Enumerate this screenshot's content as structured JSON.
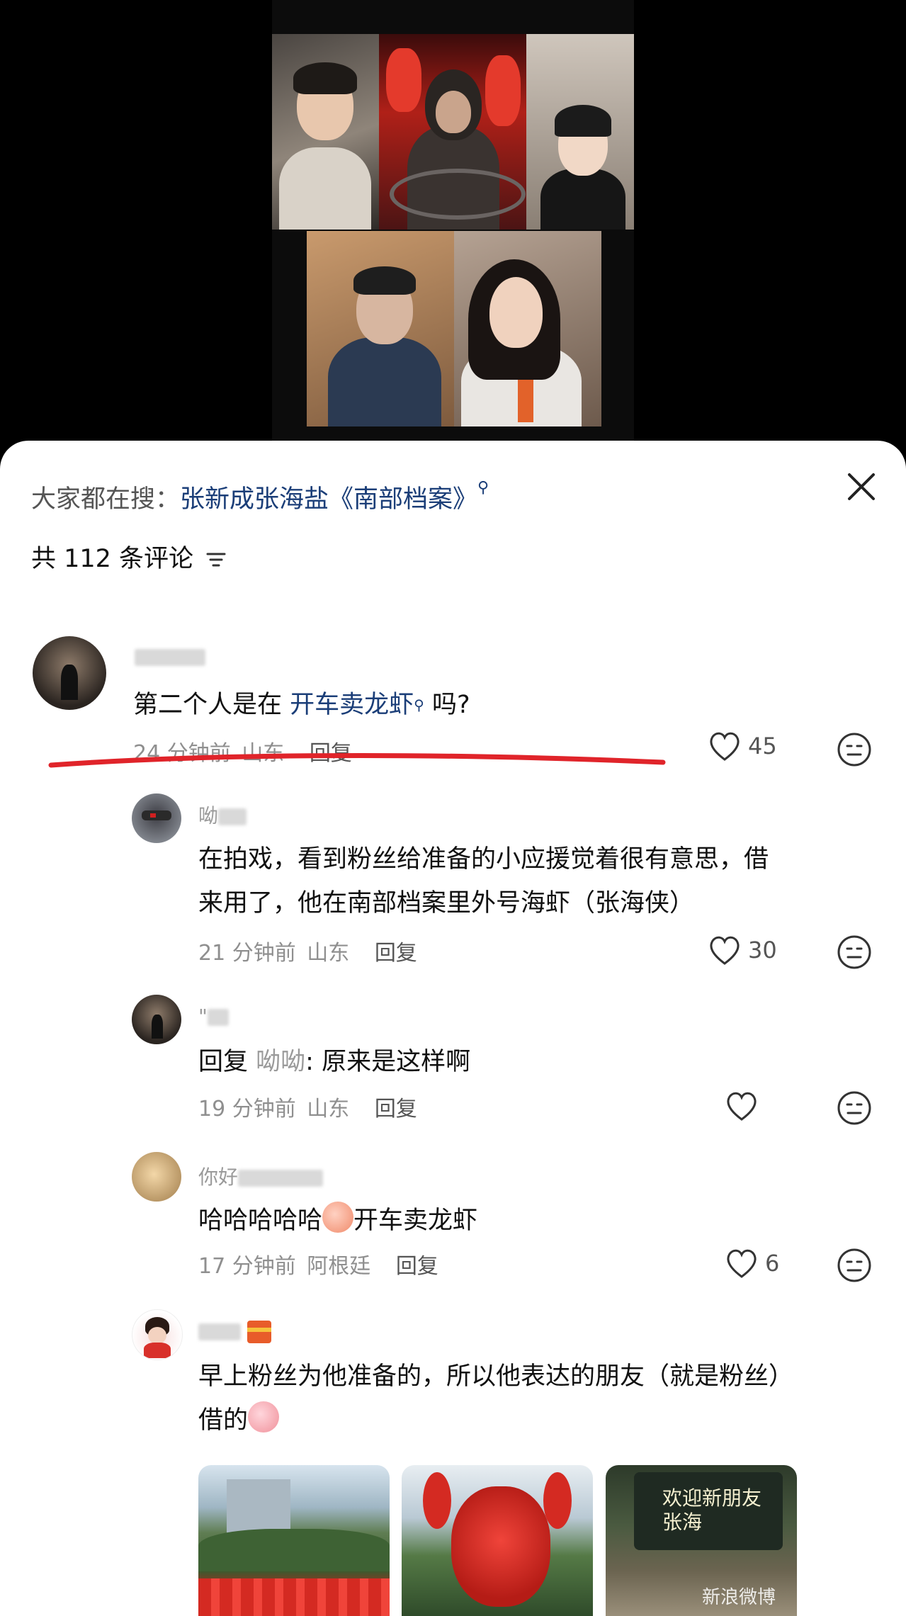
{
  "search_bar": {
    "prefix": "大家都在搜：",
    "keyword": "张新成张海盐《南部档案》",
    "icon": "search-icon"
  },
  "comments_header": {
    "label": "共 112 条评论",
    "icon": "sort-icon"
  },
  "comments": [
    {
      "username_visible": "",
      "text_before": "第二个人是在 ",
      "link_text": "开车卖龙虾",
      "text_after": " 吗?",
      "time": "24 分钟前",
      "location": "山东",
      "reply_label": "回复",
      "likes": "45"
    },
    {
      "username_visible": "呦",
      "line1": "在拍戏，看到粉丝给准备的小应援觉着很有意思，借",
      "line2": "来用了，他在南部档案里外号海虾（张海侠）",
      "time": "21 分钟前",
      "location": "山东",
      "reply_label": "回复",
      "likes": "30"
    },
    {
      "username_visible": "\"",
      "reply_prefix": "回复 ",
      "reply_to": "呦呦",
      "text": ": 原来是这样啊",
      "time": "19 分钟前",
      "location": "山东",
      "reply_label": "回复",
      "likes": ""
    },
    {
      "username_visible": "你好",
      "text_before": "哈哈哈哈哈",
      "text_after": "开车卖龙虾",
      "time": "17 分钟前",
      "location": "阿根廷",
      "reply_label": "回复",
      "likes": "6"
    },
    {
      "username_visible": "",
      "line1": "早上粉丝为他准备的，所以他表达的朋友（就是粉丝）",
      "line2": "借的",
      "photo_caption": "欢迎新朋友 张海"
    }
  ],
  "watermark": "新浪微博",
  "colors": {
    "link": "#1b3e78",
    "underline": "#e0242a",
    "meta": "#8f8f8f"
  }
}
